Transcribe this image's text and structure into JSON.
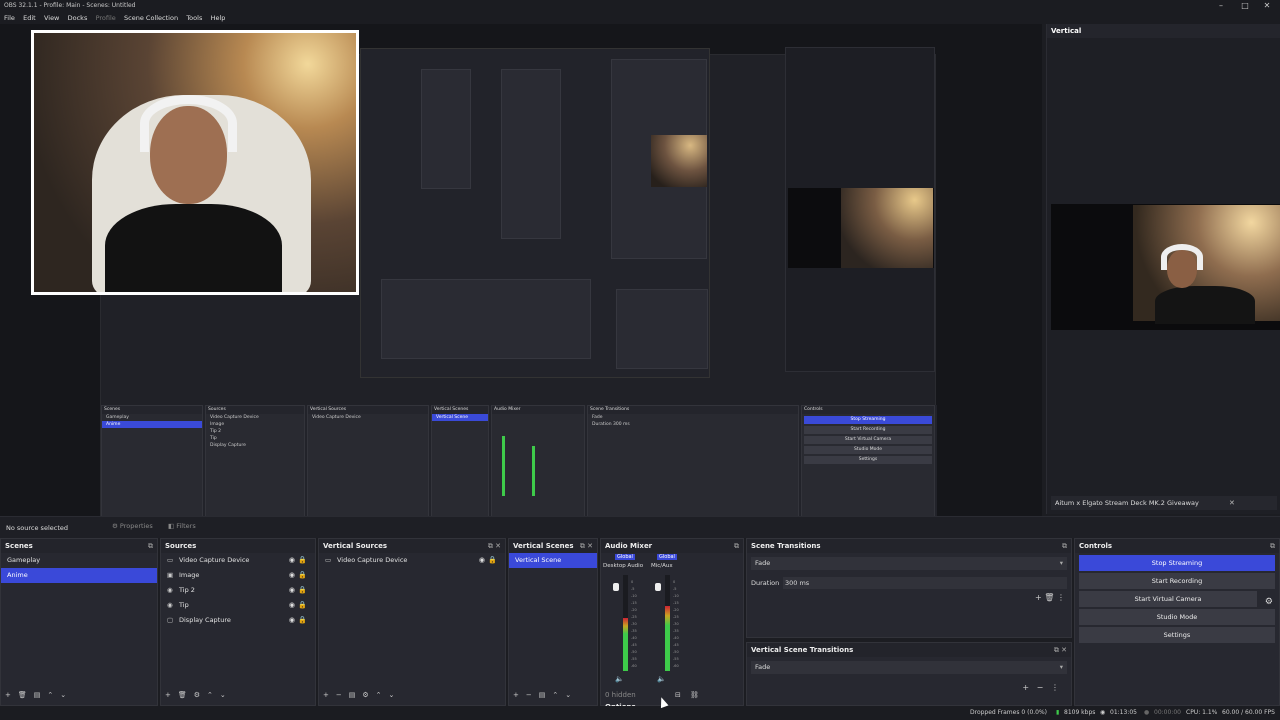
{
  "window": {
    "title": "OBS 32.1.1 - Profile: Main - Scenes: Untitled",
    "minimize": "–",
    "maximize": "□",
    "close": "✕"
  },
  "menu": [
    "File",
    "Edit",
    "View",
    "Docks",
    "Profile",
    "Scene Collection",
    "Tools",
    "Help"
  ],
  "vertical_panel": {
    "title": "Vertical",
    "notice": "Aitum x Elgato Stream Deck MK.2 Giveaway",
    "close": "✕"
  },
  "source_bar": {
    "status": "No source selected",
    "properties": "Properties",
    "filters": "Filters"
  },
  "scenes": {
    "title": "Scenes",
    "items": [
      "Gameplay",
      "Anime"
    ],
    "selected": 1
  },
  "sources": {
    "title": "Sources",
    "items": [
      {
        "icon": "▭",
        "label": "Video Capture Device"
      },
      {
        "icon": "▣",
        "label": "Image"
      },
      {
        "icon": "◉",
        "label": "Tip 2"
      },
      {
        "icon": "◉",
        "label": "Tip"
      },
      {
        "icon": "▢",
        "label": "Display Capture"
      }
    ]
  },
  "vertical_sources": {
    "title": "Vertical Sources",
    "items": [
      {
        "icon": "▭",
        "label": "Video Capture Device"
      }
    ]
  },
  "vertical_scenes": {
    "title": "Vertical Scenes",
    "items": [
      "Vertical Scene"
    ]
  },
  "audio_mixer": {
    "title": "Audio Mixer",
    "channels": [
      {
        "badge": "Global",
        "name": "Desktop Audio",
        "level": 0.55
      },
      {
        "badge": "Global",
        "name": "Mic/Aux",
        "level": 0.68
      }
    ],
    "db_scale": [
      "0",
      "-5",
      "-10",
      "-15",
      "-20",
      "-25",
      "-30",
      "-35",
      "-40",
      "-45",
      "-50",
      "-55",
      "-60"
    ],
    "hidden": "0 hidden",
    "options": "Options"
  },
  "scene_transitions": {
    "title": "Scene Transitions",
    "transition": "Fade",
    "duration_label": "Duration",
    "duration": "300 ms"
  },
  "vertical_scene_transitions": {
    "title": "Vertical Scene Transitions",
    "transition": "Fade"
  },
  "controls": {
    "title": "Controls",
    "buttons": [
      "Stop Streaming",
      "Start Recording",
      "Start Virtual Camera",
      "Studio Mode",
      "Settings"
    ]
  },
  "status": {
    "dropped": "Dropped Frames 0 (0.0%)",
    "bitrate": "8109 kbps",
    "time_live": "01:13:05",
    "time_rec": "00:00:00",
    "cpu": "CPU: 1.1%",
    "fps": "60.00 / 60.00 FPS"
  },
  "colors": {
    "accent": "#3a49d9",
    "panel": "#272830",
    "bg": "#1c1d22",
    "meter_green": "#3ecb4a"
  }
}
